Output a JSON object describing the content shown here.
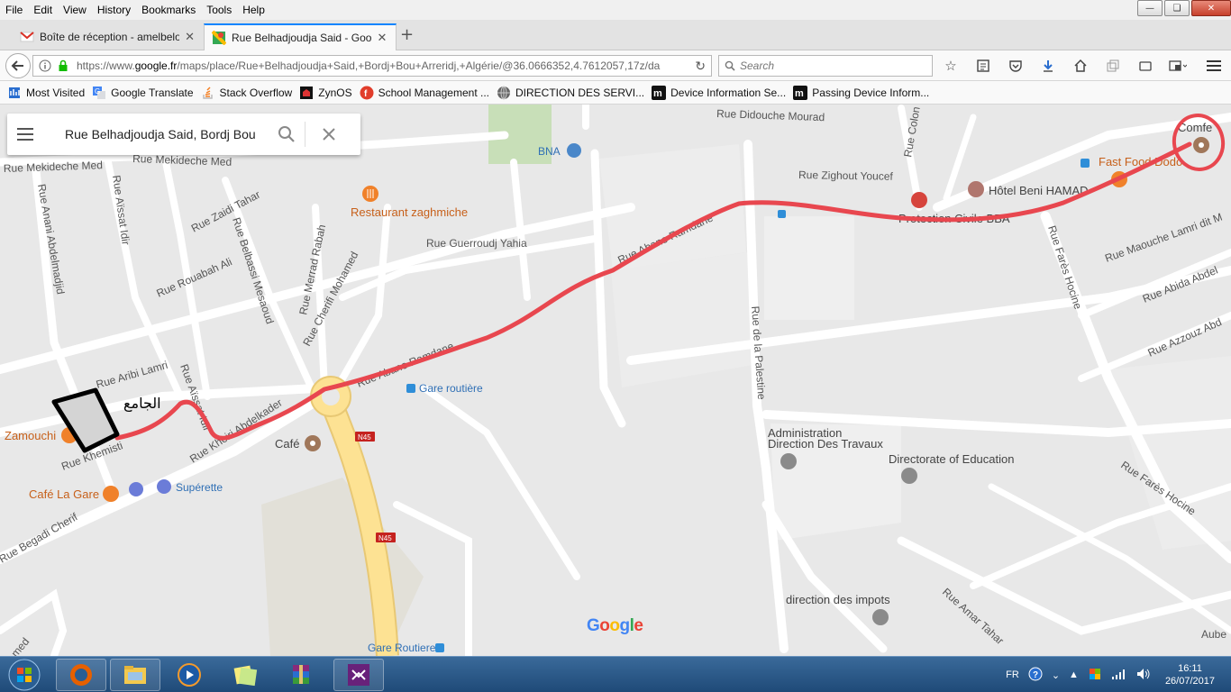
{
  "menubar": {
    "items": [
      "File",
      "Edit",
      "View",
      "History",
      "Bookmarks",
      "Tools",
      "Help"
    ]
  },
  "tabs": [
    {
      "title": "Boîte de réception - amelbelo",
      "favicon": "gmail-icon"
    },
    {
      "title": "Rue Belhadjoudja Said - Goo",
      "favicon": "google-maps-icon"
    }
  ],
  "navbar": {
    "url_prefix": "https://www.",
    "url_domain": "google.fr",
    "url_rest": "/maps/place/Rue+Belhadjoudja+Said,+Bordj+Bou+Arreridj,+Algérie/@36.0666352,4.7612057,17z/da",
    "search_placeholder": "Search"
  },
  "bookmarks": [
    {
      "label": "Most Visited",
      "icon": "bookmarks-folder-icon"
    },
    {
      "label": "Google Translate",
      "icon": "google-translate-icon"
    },
    {
      "label": "Stack Overflow",
      "icon": "stackoverflow-icon"
    },
    {
      "label": "ZynOS",
      "icon": "zynos-icon"
    },
    {
      "label": "School Management ...",
      "icon": "school-icon"
    },
    {
      "label": "DIRECTION DES SERVI...",
      "icon": "globe-icon"
    },
    {
      "label": "Device Information Se...",
      "icon": "m-icon"
    },
    {
      "label": "Passing Device Inform...",
      "icon": "m-icon"
    }
  ],
  "map_search": {
    "query": "Rue Belhadjoudja Said, Bordj Bou"
  },
  "map": {
    "streets": [
      "Rue Didouche Mourad",
      "Rue Mekideche Med",
      "Rue Mekideche Med",
      "Rue Zighout Youcef",
      "Rue Zaidi Tahar",
      "Rue Aïssat Idir",
      "Rue Anani Abdelmadjid",
      "Rue Belbassi Mesaoud",
      "Rue Merrad Rabah",
      "Rue Cherifi Mohamed",
      "Rue Guerroudj Yahia",
      "Rue Rouabah Ali",
      "Rue Abane Ramdane",
      "Rue Abane Ramdane",
      "Rue Aribi Lamri",
      "Rue Aïssat Idir",
      "Rue Khemisti",
      "Rue Kheiri Abdelkader",
      "Rue Begadi Cherif",
      "Rue de la Palestine",
      "Rue Farès Hocine",
      "Rue Farès Hocine",
      "Rue Maouche Lamri dit M",
      "Rue Abida Abdel",
      "Rue Azzouz Abd",
      "Rue Amar Tahar",
      "Rue Colon",
      "med",
      "Aube"
    ],
    "pois": {
      "bna": "BNA",
      "restaurant": "Restaurant zaghmiche",
      "gare_routiere_top": "Gare routière",
      "cafe": "Café",
      "zamouchi": "Zamouchi",
      "cafe_la_gare": "Café La Gare",
      "superette": "Supérette",
      "administration": "Administration",
      "direction_travaux": "Direction Des Travaux",
      "directorate": "Directorate of Education",
      "direction_impots": "direction des impots",
      "gare_routiere_bottom": "Gare Routiere",
      "protection_civile": "Protection Civile BBA",
      "hotel": "Hôtel Beni HAMAD",
      "fast_food": "Fast Food Dodo",
      "comfe": "Comfe",
      "road_badge": "N45"
    },
    "handwritten_label": "الجامع"
  },
  "google_logo": "Google",
  "taskbar": {
    "apps": [
      "firefox-icon",
      "file-explorer-icon",
      "media-player-icon",
      "notes-icon",
      "winrar-icon",
      "visual-studio-icon"
    ],
    "language": "FR",
    "time": "16:11",
    "date": "26/07/2017"
  },
  "colors": {
    "route": "#e8474f",
    "accent": "#0a84ff",
    "road_major": "#fde293"
  }
}
